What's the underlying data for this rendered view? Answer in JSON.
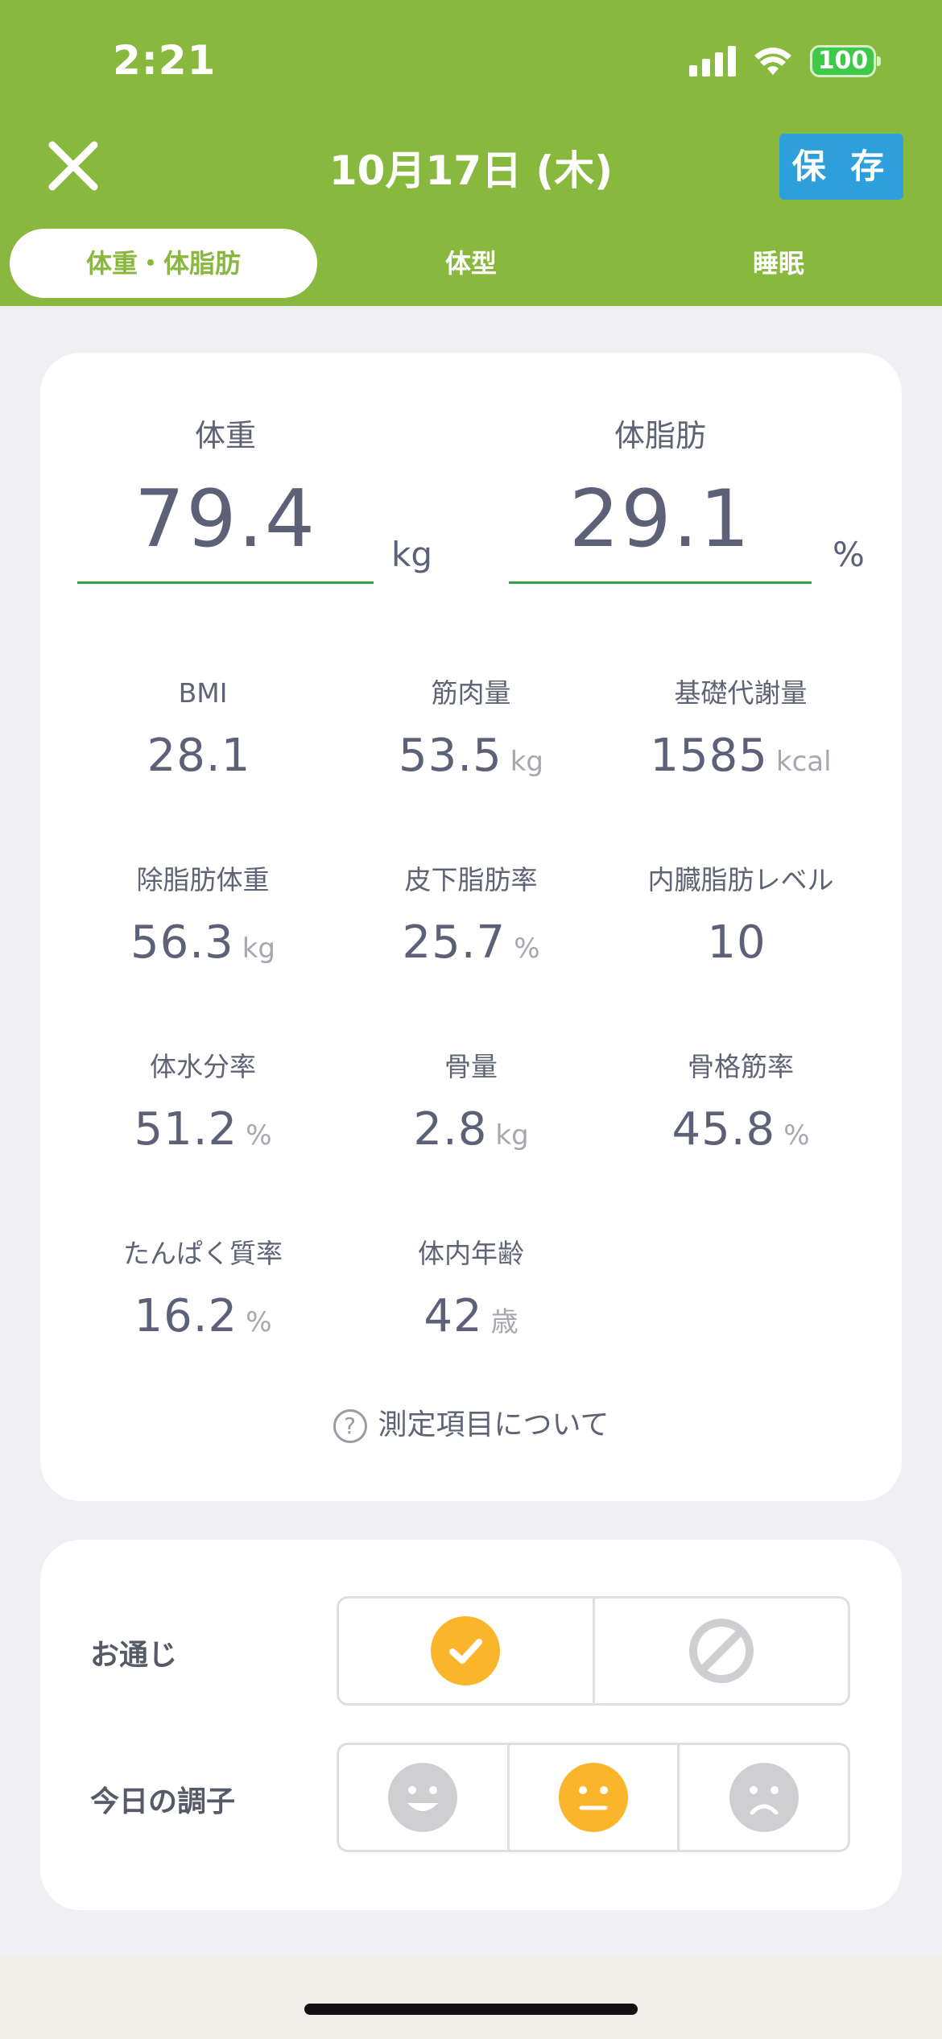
{
  "status_bar": {
    "time": "2:21",
    "battery": "100"
  },
  "header": {
    "title": "10月17日 (木)",
    "save_label": "保 存"
  },
  "tabs": [
    {
      "label": "体重・体脂肪",
      "active": true
    },
    {
      "label": "体型",
      "active": false
    },
    {
      "label": "睡眠",
      "active": false
    }
  ],
  "weight": {
    "label": "体重",
    "value": "79.4",
    "unit": "kg"
  },
  "body_fat": {
    "label": "体脂肪",
    "value": "29.1",
    "unit": "%"
  },
  "metrics": [
    {
      "label": "BMI",
      "value": "28.1",
      "unit": ""
    },
    {
      "label": "筋肉量",
      "value": "53.5",
      "unit": "kg"
    },
    {
      "label": "基礎代謝量",
      "value": "1585",
      "unit": "kcal"
    },
    {
      "label": "除脂肪体重",
      "value": "56.3",
      "unit": "kg"
    },
    {
      "label": "皮下脂肪率",
      "value": "25.7",
      "unit": "%"
    },
    {
      "label": "内臓脂肪レベル",
      "value": "10",
      "unit": ""
    },
    {
      "label": "体水分率",
      "value": "51.2",
      "unit": "%"
    },
    {
      "label": "骨量",
      "value": "2.8",
      "unit": "kg"
    },
    {
      "label": "骨格筋率",
      "value": "45.8",
      "unit": "%"
    },
    {
      "label": "たんぱく質率",
      "value": "16.2",
      "unit": "%"
    },
    {
      "label": "体内年齢",
      "value": "42",
      "unit": "歳"
    }
  ],
  "help_link": "測定項目について",
  "bowel": {
    "label": "お通じ",
    "options": [
      "check-icon",
      "none-icon"
    ],
    "selected": "check-icon"
  },
  "condition": {
    "label": "今日の調子",
    "options": [
      "smile-icon",
      "neutral-face-icon",
      "sad-face-icon"
    ],
    "selected": "neutral-face-icon"
  },
  "colors": {
    "header_green": "#88b83e",
    "save_blue": "#2d9fdb",
    "selected_orange": "#fbb52a",
    "unselected_gray": "#cfcfd1",
    "underline_green": "#3aa142"
  }
}
